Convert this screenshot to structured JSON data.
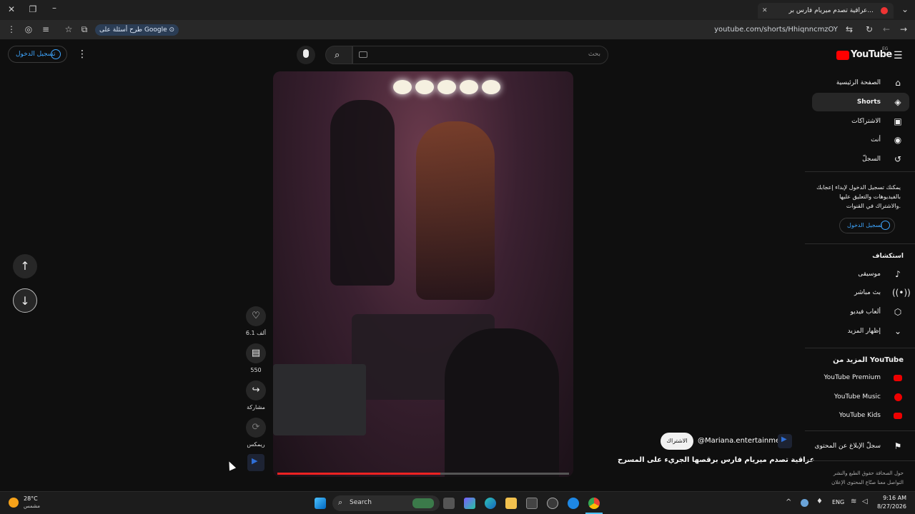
{
  "browser": {
    "tab_title": "عراقية تصدم ميريام فارس بر...",
    "google_ask": "طرح أسئلة على Google",
    "url": "youtube.com/shorts/HhiqnncmzOY"
  },
  "youtube": {
    "logo_text": "YouTube",
    "country": "EG",
    "search_placeholder": "بحث",
    "signin_label": "تسجيل الدخول",
    "sidebar": {
      "main": [
        {
          "label": "الصفحة الرئيسية",
          "icon": "home-icon"
        },
        {
          "label": "Shorts",
          "icon": "shorts-icon",
          "active": true
        },
        {
          "label": "الاشتراكات",
          "icon": "subscriptions-icon"
        },
        {
          "label": "أنت",
          "icon": "you-icon"
        },
        {
          "label": "السجلّ",
          "icon": "history-icon"
        }
      ],
      "signin_prompt": "يمكنك تسجيل الدخول لإبداء إعجابك بالفيديوهات والتعليق عليها والاشتراك في القنوات.",
      "signin_button": "تسجيل الدخول",
      "explore_heading": "استكشاف",
      "explore": [
        {
          "label": "موسيقى",
          "icon": "music-icon"
        },
        {
          "label": "بث مباشر",
          "icon": "live-icon"
        },
        {
          "label": "ألعاب فيديو",
          "icon": "gaming-icon"
        },
        {
          "label": "إظهار المزيد",
          "icon": "chevron-down-icon"
        }
      ],
      "more_heading": "المزيد من YouTube",
      "more": [
        {
          "label": "YouTube Premium"
        },
        {
          "label": "YouTube Music"
        },
        {
          "label": "YouTube Kids"
        }
      ],
      "report_label": "سجلّ الإبلاغ عن المحتوى",
      "footer_line1": "حول  الصحافة  حقوق الطبع والنشر",
      "footer_line2": "التواصل معنا  صنّاع المحتوى  الإعلان"
    },
    "short": {
      "likes": "6.1 ألف",
      "comments": "550",
      "share": "مشاركة",
      "remix": "ريمكس",
      "channel": "@Mariana.entertainment",
      "subscribe": "الاشتراك",
      "title": "عراقية تصدم ميريام فارس برقصها الجريء على المسرح",
      "progress": 0.56
    }
  },
  "taskbar": {
    "weather_temp": "28°C",
    "weather_desc": "مشمس",
    "search": "Search",
    "lang": "ENG",
    "time": "9:16 AM",
    "date": "8/27/2026"
  }
}
